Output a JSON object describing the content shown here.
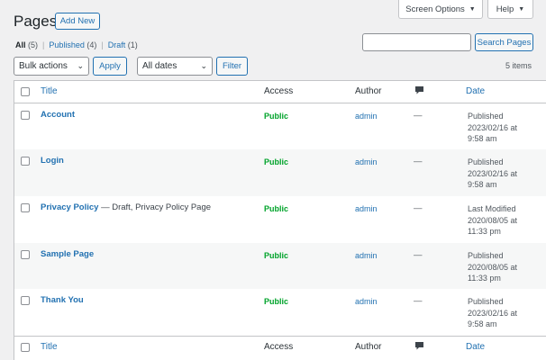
{
  "screen_meta": {
    "screen_options_label": "Screen Options",
    "help_label": "Help",
    "caret": "▼"
  },
  "header": {
    "title": "Pages",
    "add_new_label": "Add New"
  },
  "views": [
    {
      "label": "All",
      "count": "(5)"
    },
    {
      "label": "Published",
      "count": "(4)"
    },
    {
      "label": "Draft",
      "count": "(1)"
    }
  ],
  "views_separator": "|",
  "search": {
    "value": "",
    "button_label": "Search Pages"
  },
  "tablenav": {
    "bulk_actions_value": "Bulk actions",
    "apply_label": "Apply",
    "dates_value": "All dates",
    "filter_label": "Filter",
    "items_count": "5 items",
    "chevron": "⌄"
  },
  "columns": {
    "title": "Title",
    "access": "Access",
    "author": "Author",
    "comments_icon": "comment-bubble-icon",
    "date": "Date"
  },
  "rows": [
    {
      "title": "Account",
      "state": "",
      "access": "Public",
      "author": "admin",
      "comments": "—",
      "date_status": "Published",
      "date_day": "2023/02/16 at",
      "date_time": "9:58 am"
    },
    {
      "title": "Login",
      "state": "",
      "access": "Public",
      "author": "admin",
      "comments": "—",
      "date_status": "Published",
      "date_day": "2023/02/16 at",
      "date_time": "9:58 am"
    },
    {
      "title": "Privacy Policy",
      "state": " — Draft, Privacy Policy Page",
      "access": "Public",
      "author": "admin",
      "comments": "—",
      "date_status": "Last Modified",
      "date_day": "2020/08/05 at",
      "date_time": "11:33 pm"
    },
    {
      "title": "Sample Page",
      "state": "",
      "access": "Public",
      "author": "admin",
      "comments": "—",
      "date_status": "Published",
      "date_day": "2020/08/05 at",
      "date_time": "11:33 pm"
    },
    {
      "title": "Thank You",
      "state": "",
      "access": "Public",
      "author": "admin",
      "comments": "—",
      "date_status": "Published",
      "date_day": "2023/02/16 at",
      "date_time": "9:58 am"
    }
  ],
  "colors": {
    "accent": "#2271b1",
    "public": "#00a32a",
    "background": "#f0f0f1"
  }
}
